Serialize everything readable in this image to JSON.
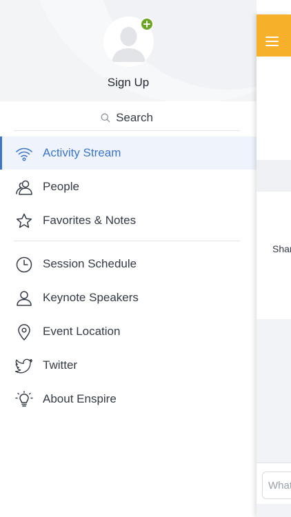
{
  "profile": {
    "signup_label": "Sign Up"
  },
  "search": {
    "label": "Search"
  },
  "menu": {
    "primary": [
      {
        "label": "Activity Stream",
        "icon": "wifi-icon",
        "active": true
      },
      {
        "label": "People",
        "icon": "people-icon",
        "active": false
      },
      {
        "label": "Favorites & Notes",
        "icon": "star-icon",
        "active": false
      }
    ],
    "secondary": [
      {
        "label": "Session Schedule",
        "icon": "clock-icon"
      },
      {
        "label": "Keynote Speakers",
        "icon": "person-icon"
      },
      {
        "label": "Event Location",
        "icon": "location-pin-icon"
      },
      {
        "label": "Twitter",
        "icon": "twitter-icon"
      },
      {
        "label": "About Enspire",
        "icon": "lightbulb-icon"
      }
    ]
  },
  "main_panel": {
    "share_text": "Shar",
    "composer_placeholder": "What"
  },
  "colors": {
    "accent": "#3b75c9",
    "topbar": "#f6b02a",
    "badge": "#6aa622",
    "icon_stroke": "#333a45"
  }
}
